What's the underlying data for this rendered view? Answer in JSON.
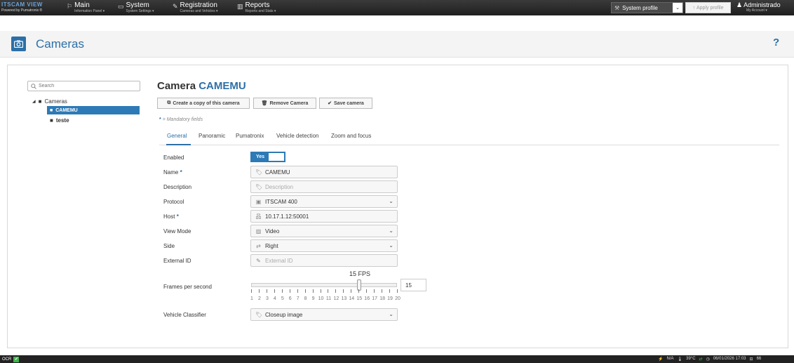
{
  "colors": {
    "accent": "#2d6fa7",
    "selected": "#2d7ab6",
    "topbar": "#2a2a2a"
  },
  "topbar": {
    "logo_main": "ITSCAM",
    "logo_sub": "VIEW",
    "logo_powered": "Powered by Pumatronix ®",
    "nav": [
      {
        "icon": "flag-icon",
        "title": "Main",
        "subtitle": "Information Panel ▾"
      },
      {
        "icon": "monitor-icon",
        "title": "System",
        "subtitle": "System Settings ▾"
      },
      {
        "icon": "edit-icon",
        "title": "Registration",
        "subtitle": "Cameras and Vehicles ▾"
      },
      {
        "icon": "bar-chart-icon",
        "title": "Reports",
        "subtitle": "Reports and Stats ▾"
      }
    ],
    "profile_select": "System profile",
    "apply_profile": "Apply profile",
    "account_name": "Administrado",
    "account_sub": "My Account ▾"
  },
  "page": {
    "title": "Cameras",
    "help": "?"
  },
  "sidebar": {
    "search_placeholder": "Search",
    "root_label": "Cameras",
    "items": [
      {
        "label": "CAMEMU",
        "selected": true
      },
      {
        "label": "teste",
        "selected": false
      }
    ]
  },
  "form": {
    "heading_prefix": "Camera",
    "heading_name": "CAMEMU",
    "buttons": {
      "copy": "Create a copy of this camera",
      "remove": "Remove Camera",
      "save": "Save camera"
    },
    "mandatory_note": "= Mandatory fields",
    "mandatory_star": "*",
    "tabs": [
      "General",
      "Panoramic",
      "Pumatronix",
      "Vehicle detection",
      "Zoom and focus"
    ],
    "active_tab": "General",
    "fields": {
      "enabled": {
        "label": "Enabled",
        "value": "Yes"
      },
      "name": {
        "label": "Name",
        "value": "CAMEMU",
        "required": true
      },
      "description": {
        "label": "Description",
        "placeholder": "Description"
      },
      "protocol": {
        "label": "Protocol",
        "value": "ITSCAM 400"
      },
      "host": {
        "label": "Host",
        "value": "10.17.1.12:50001",
        "required": true
      },
      "view_mode": {
        "label": "View Mode",
        "value": "Video"
      },
      "side": {
        "label": "Side",
        "value": "Right"
      },
      "external_id": {
        "label": "External ID",
        "placeholder": "External ID"
      },
      "fps": {
        "label": "Frames per second",
        "value": "15",
        "display": "15 FPS",
        "min": 1,
        "max": 20,
        "tick_labels": [
          "1",
          "2",
          "3",
          "4",
          "5",
          "6",
          "7",
          "8",
          "9",
          "10",
          "11",
          "12",
          "13",
          "14",
          "15",
          "16",
          "17",
          "18",
          "19",
          "20"
        ]
      },
      "classifier": {
        "label": "Vehicle Classifier",
        "value": "Closeup image"
      }
    }
  },
  "footer": {
    "ocr": "OCR",
    "network": "N/A",
    "temperature": "39°C",
    "datetime": "06/01/2026 17:03",
    "disk": "66"
  }
}
